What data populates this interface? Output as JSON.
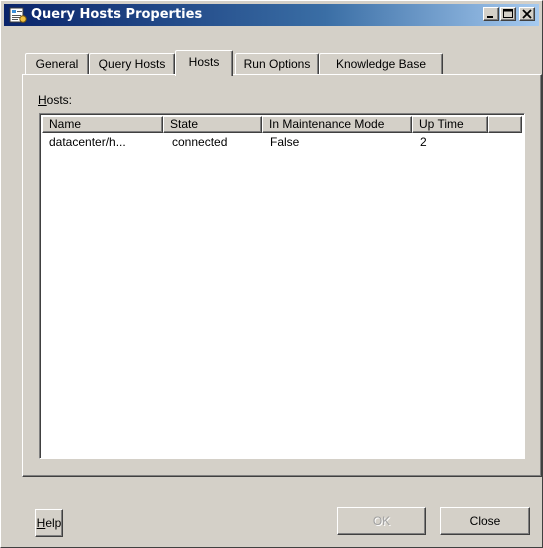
{
  "window": {
    "title": "Query Hosts Properties",
    "icon": "properties-icon"
  },
  "tabs": [
    {
      "label": "General",
      "active": false
    },
    {
      "label": "Query Hosts",
      "active": false
    },
    {
      "label": "Hosts",
      "active": true
    },
    {
      "label": "Run Options",
      "active": false
    },
    {
      "label": "Knowledge Base",
      "active": false
    }
  ],
  "hosts": {
    "label_accel": "H",
    "label_rest": "osts:",
    "columns": [
      "Name",
      "State",
      "In Maintenance Mode",
      "Up Time",
      ""
    ],
    "rows": [
      [
        "datacenter/h...",
        "connected",
        "False",
        "2"
      ]
    ]
  },
  "buttons": {
    "help_accel": "H",
    "help_rest": "elp",
    "ok": "OK",
    "close": "Close"
  },
  "colors": {
    "titlebar_start": "#0a246a",
    "titlebar_end": "#a6caf0",
    "face": "#d4d0c8"
  }
}
